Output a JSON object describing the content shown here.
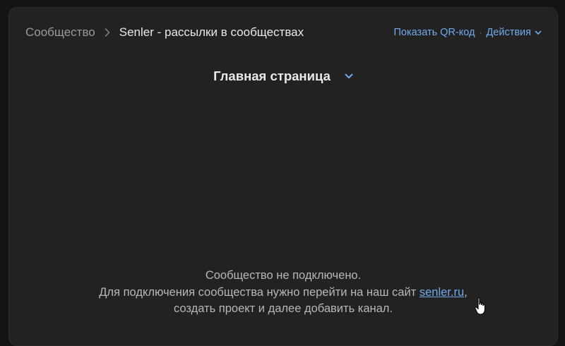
{
  "breadcrumb": {
    "root": "Сообщество",
    "current": "Senler - рассылки в сообществах"
  },
  "actions": {
    "qr_label": "Показать QR-код",
    "separator": "·",
    "actions_label": "Действия"
  },
  "page_select": {
    "selected": "Главная страница"
  },
  "message": {
    "line1": "Сообщество не подключено.",
    "line2_prefix": "Для подключения сообщества нужно перейти на наш сайт ",
    "link_text": "senler.ru",
    "line2_suffix": ",",
    "line3": "создать проект и далее добавить канал."
  },
  "icons": {
    "breadcrumb_separator": "chevron-right-icon",
    "actions_dropdown": "chevron-down-icon",
    "page_select_dropdown": "chevron-down-icon",
    "cursor": "hand-pointer-icon"
  },
  "colors": {
    "background": "#141414",
    "panel": "#222222",
    "accent": "#71aaeb",
    "text_primary": "#e8e8e8",
    "text_secondary": "#9a9a9a"
  }
}
